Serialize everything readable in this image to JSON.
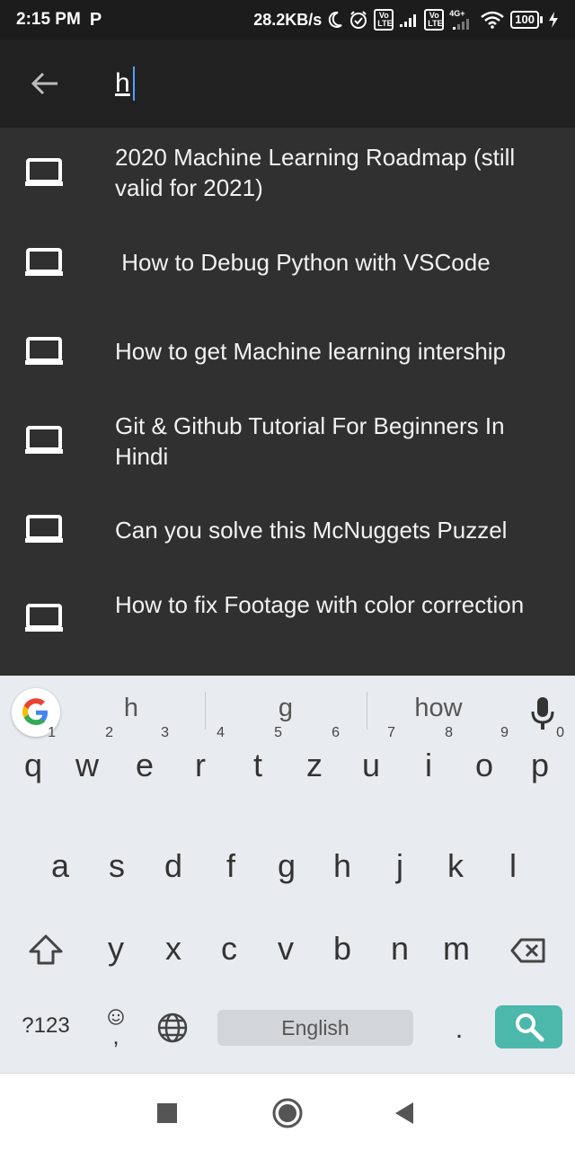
{
  "status_bar": {
    "time": "2:15 PM",
    "carrier_icon": "P",
    "net_speed": "28.2KB/s",
    "volte1": "Vo LTE",
    "volte2": "Vo LTE",
    "network_type": "4G+",
    "battery": "100"
  },
  "search": {
    "query": "h",
    "back_icon": "arrow-back-icon"
  },
  "results": [
    {
      "title": "2020 Machine Learning Roadmap (still valid for 2021)",
      "icon": "laptop-icon"
    },
    {
      "title": " How to Debug Python with VSCode",
      "icon": "laptop-icon"
    },
    {
      "title": "How to get Machine learning intership",
      "icon": "laptop-icon"
    },
    {
      "title": "Git & Github Tutorial For Beginners In Hindi",
      "icon": "laptop-icon"
    },
    {
      "title": "Can you solve this McNuggets Puzzel",
      "icon": "laptop-icon"
    },
    {
      "title": "How to fix Footage with color correction",
      "icon": "laptop-icon"
    }
  ],
  "keyboard": {
    "suggestions": [
      "h",
      "g",
      "how"
    ],
    "row1": [
      {
        "key": "q",
        "num": "1"
      },
      {
        "key": "w",
        "num": "2"
      },
      {
        "key": "e",
        "num": "3"
      },
      {
        "key": "r",
        "num": "4"
      },
      {
        "key": "t",
        "num": "5"
      },
      {
        "key": "z",
        "num": "6"
      },
      {
        "key": "u",
        "num": "7"
      },
      {
        "key": "i",
        "num": "8"
      },
      {
        "key": "o",
        "num": "9"
      },
      {
        "key": "p",
        "num": "0"
      }
    ],
    "row2": [
      "a",
      "s",
      "d",
      "f",
      "g",
      "h",
      "j",
      "k",
      "l"
    ],
    "row3": [
      "y",
      "x",
      "c",
      "v",
      "b",
      "n",
      "m"
    ],
    "symbols_label": "?123",
    "emoji_comma": ",",
    "space_label": "English",
    "period": "."
  },
  "colors": {
    "toolbar": "#212121",
    "list_bg": "#303030",
    "keyboard_bg": "#e8ebef",
    "search_key": "#4bb8ab",
    "caret": "#4fa3ff"
  }
}
